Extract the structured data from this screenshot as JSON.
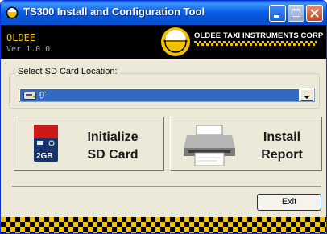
{
  "window": {
    "title": "TS300 Install and Configuration Tool"
  },
  "header": {
    "brand": "OLDEE",
    "version": "Ver 1.0.0",
    "corp": "OLDEE TAXI INSTRUMENTS CORP"
  },
  "sd_location": {
    "label": "Select SD Card Location:",
    "selected_value": "g:",
    "drive_icon": "drive-icon"
  },
  "buttons": {
    "initialize_label": "Initialize\nSD Card",
    "install_report_label": "Install\nReport",
    "exit_label": "Exit"
  },
  "sd_card_icon": {
    "capacity": "2GB"
  },
  "colors": {
    "title_bar": "#0a5fe6",
    "header_bg": "#000000",
    "brand_yellow": "#f2c200",
    "selection_blue": "#316ac5"
  }
}
